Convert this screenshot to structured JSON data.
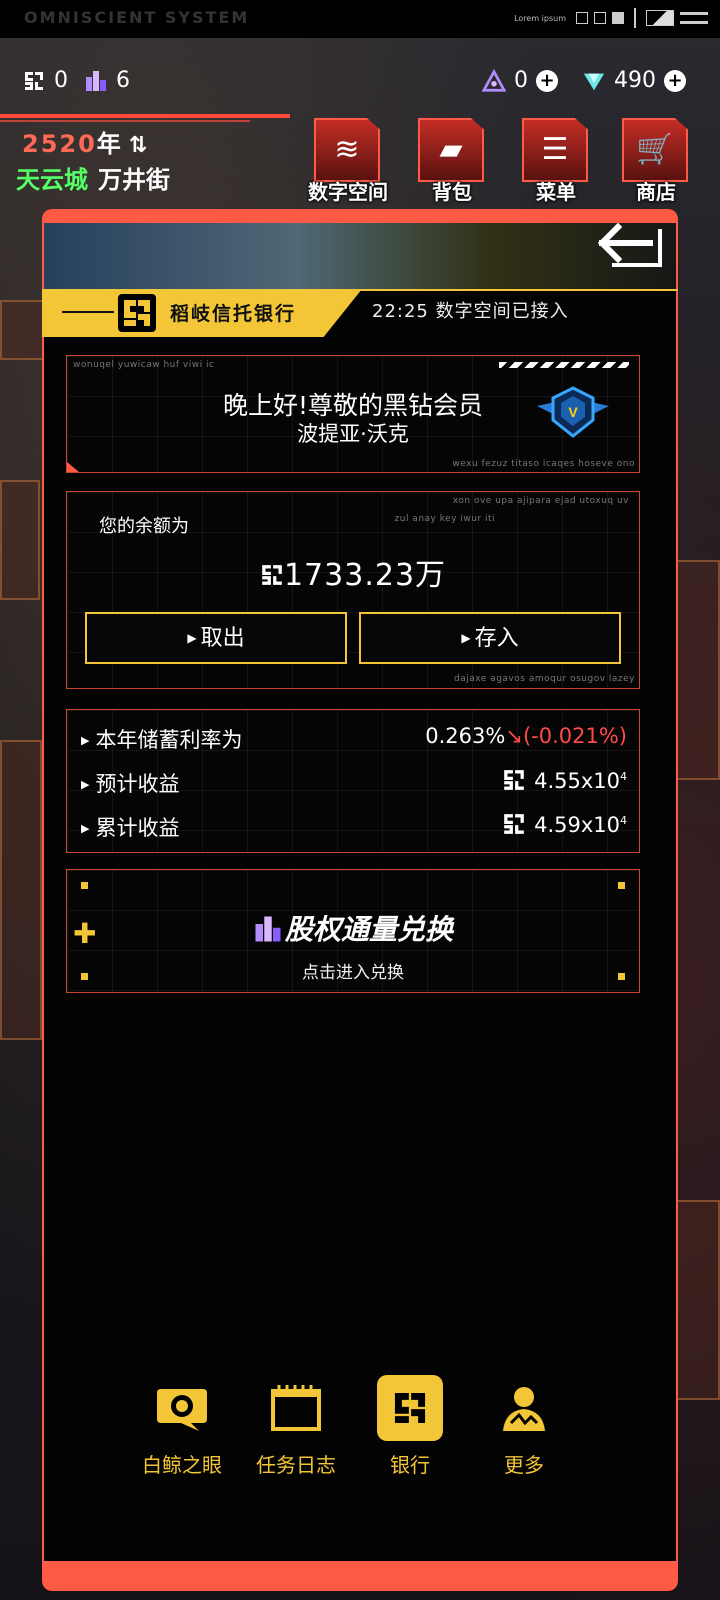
{
  "statusbar": {
    "brand": "OMNISCIENT SYSTEM",
    "lorem": "Lorem ipsum"
  },
  "resources": {
    "chips": "0",
    "stock": "6",
    "triangle": "0",
    "gems": "490"
  },
  "location": {
    "year": "2520",
    "year_unit": "年",
    "city": "天云城",
    "street": "万井街"
  },
  "top_nav": [
    {
      "label": "数字空间",
      "icon": "digital-space-icon"
    },
    {
      "label": "背包",
      "icon": "backpack-icon"
    },
    {
      "label": "菜单",
      "icon": "menu-icon"
    },
    {
      "label": "商店",
      "icon": "shop-icon"
    }
  ],
  "bank": {
    "name": "稻岐信托银行",
    "time": "22:25",
    "status": "数字空间已接入"
  },
  "greeting": {
    "line1": "晚上好!尊敬的黑钻会员",
    "line2": "波提亚·沃克",
    "tiny_top": "wonuqel yuwicaw huf viwi ic",
    "tiny_bottom": "wexu fezuz titaso icaqes hoseve ono",
    "badge_letter": "V"
  },
  "balance": {
    "label": "您的余额为",
    "amount": "1733.23万",
    "withdraw": "取出",
    "deposit": "存入",
    "tiny_top1": "xon ove upa ajipara ejad utoxuq uv",
    "tiny_top2": "zul anay key iwur iti",
    "tiny_bottom": "dajaxe agavos amoqur osugov lazey"
  },
  "rates": {
    "rate_label": "本年储蓄利率为",
    "rate_value": "0.263%",
    "rate_change": "(-0.021%)",
    "expected_label": "预计收益",
    "expected_value": "4.55x10",
    "expected_exp": "4",
    "cumulative_label": "累计收益",
    "cumulative_value": "4.59x10",
    "cumulative_exp": "4"
  },
  "exchange": {
    "title": "股权通量兑换",
    "subtitle": "点击进入兑换"
  },
  "bottom_nav": [
    {
      "label": "白鲸之眼",
      "icon": "eye-icon"
    },
    {
      "label": "任务日志",
      "icon": "calendar-icon"
    },
    {
      "label": "银行",
      "icon": "bank-icon"
    },
    {
      "label": "更多",
      "icon": "person-icon"
    }
  ],
  "colors": {
    "accent_red": "#ff5a46",
    "accent_yellow": "#f2c636",
    "city_green": "#55ff66",
    "negative": "#ff4a4a"
  }
}
